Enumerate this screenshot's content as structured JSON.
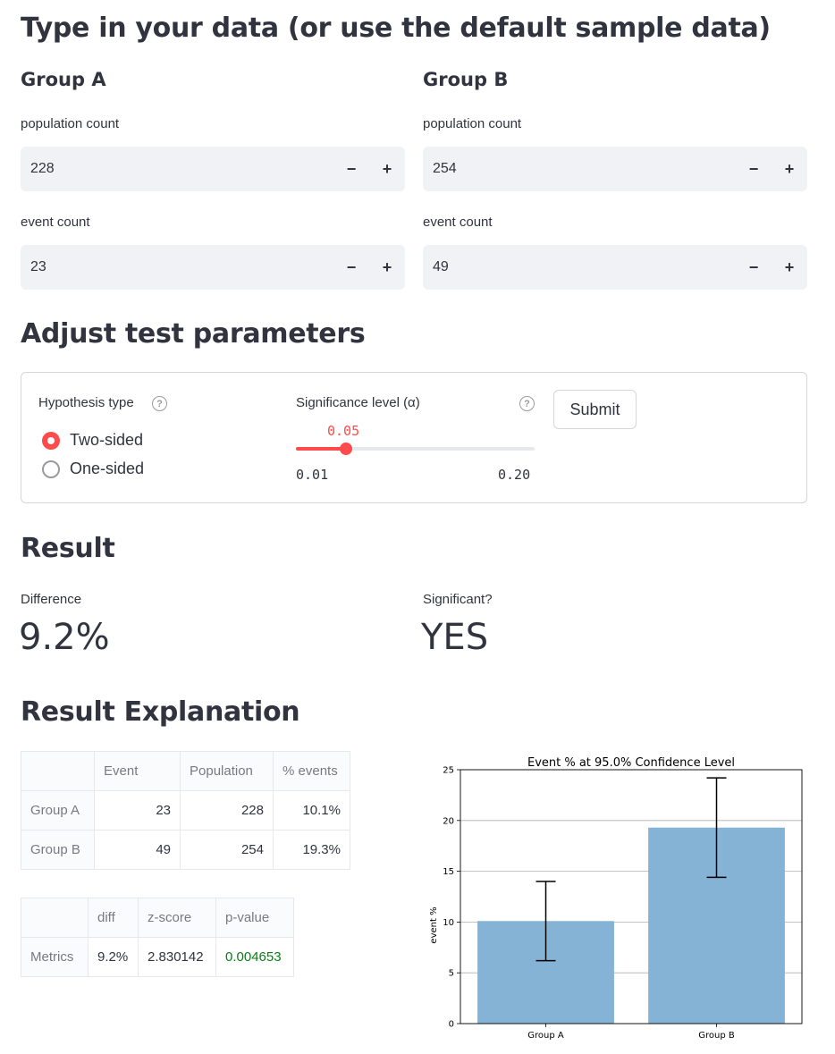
{
  "input_section": {
    "heading": "Type in your data (or use the default sample data)",
    "group_a": {
      "title": "Group A",
      "population_label": "population count",
      "population_value": "228",
      "event_label": "event count",
      "event_value": "23"
    },
    "group_b": {
      "title": "Group B",
      "population_label": "population count",
      "population_value": "254",
      "event_label": "event count",
      "event_value": "49"
    },
    "minus": "−",
    "plus": "+"
  },
  "params": {
    "heading": "Adjust test parameters",
    "hypothesis_label": "Hypothesis type",
    "options": [
      "Two-sided",
      "One-sided"
    ],
    "selected_option": "Two-sided",
    "significance_label": "Significance level (α)",
    "slider_value": "0.05",
    "slider_min": "0.01",
    "slider_max": "0.20",
    "slider_fraction": 0.2105,
    "help_glyph": "?",
    "submit": "Submit"
  },
  "result": {
    "heading": "Result",
    "difference_label": "Difference",
    "difference_value": "9.2%",
    "significant_label": "Significant?",
    "significant_value": "YES"
  },
  "explanation": {
    "heading": "Result Explanation",
    "table1": {
      "columns": [
        "Event",
        "Population",
        "% events"
      ],
      "rows": [
        {
          "name": "Group A",
          "cells": [
            "23",
            "228",
            "10.1%"
          ]
        },
        {
          "name": "Group B",
          "cells": [
            "49",
            "254",
            "19.3%"
          ]
        }
      ]
    },
    "table2": {
      "columns": [
        "diff",
        "z-score",
        "p-value"
      ],
      "rows": [
        {
          "name": "Metrics",
          "cells": [
            "9.2%",
            "2.830142",
            "0.004653"
          ]
        }
      ]
    },
    "colors": {
      "p_value_green": "#0b7d17",
      "accent": "#ff4b4b",
      "bar": "#85b3d5"
    }
  },
  "chart_data": {
    "type": "bar",
    "title": "Event % at 95.0% Confidence Level",
    "xlabel": "",
    "ylabel": "event %",
    "categories": [
      "Group A",
      "Group B"
    ],
    "values": [
      10.1,
      19.3
    ],
    "error_low": [
      6.2,
      14.4
    ],
    "error_high": [
      14.0,
      24.2
    ],
    "ylim": [
      0,
      25
    ],
    "yticks": [
      "0",
      "5",
      "10",
      "15",
      "20",
      "25"
    ],
    "grid": true
  }
}
